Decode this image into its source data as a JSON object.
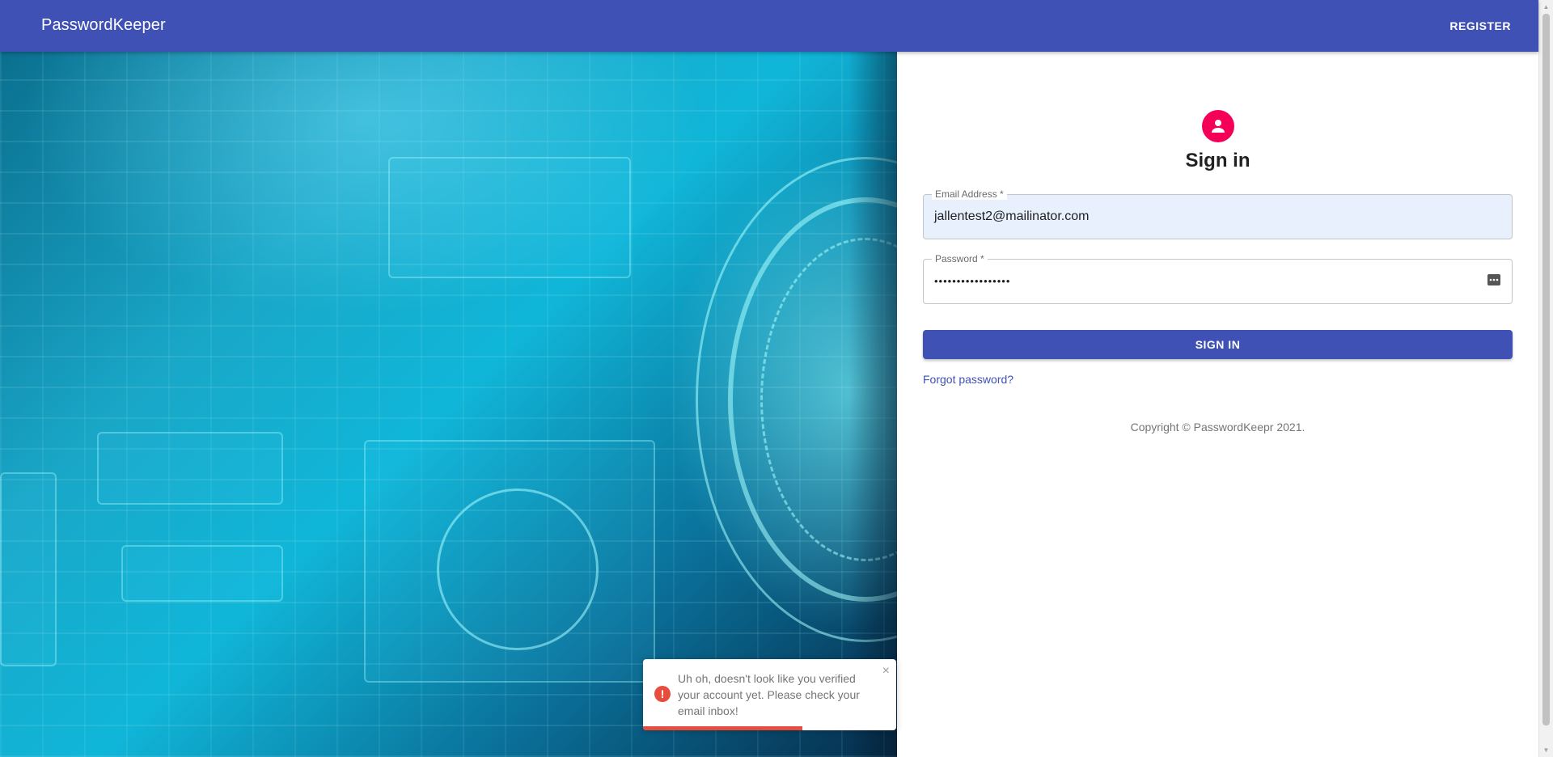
{
  "appbar": {
    "brand": "PasswordKeeper",
    "register_label": "REGISTER",
    "color": "#3f51b5"
  },
  "signin": {
    "avatar_icon": "person-icon",
    "avatar_color": "#f50057",
    "title": "Sign in",
    "email": {
      "label": "Email Address *",
      "value": "jallentest2@mailinator.com"
    },
    "password": {
      "label": "Password *",
      "value": "•••••••••••••••••",
      "icon": "password-dots-icon"
    },
    "button_label": "SIGN IN",
    "forgot_label": "Forgot password?",
    "copyright": "Copyright © PasswordKeepr 2021."
  },
  "toast": {
    "icon": "error-icon",
    "message": "Uh oh, doesn't look like you verified your account yet. Please check your email inbox!",
    "close_label": "×",
    "progress": 0.63,
    "color": "#e74c3c"
  }
}
